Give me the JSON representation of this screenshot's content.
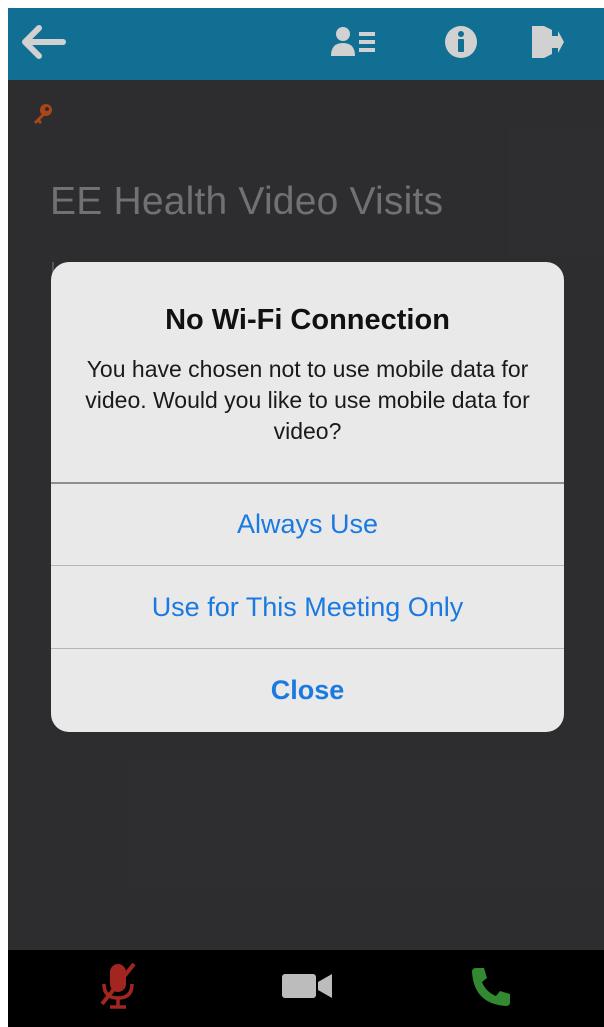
{
  "colors": {
    "toolbar": "#1588b4",
    "background": "#38383a",
    "accent_blue": "#1a7ae0",
    "key_orange": "#d2561c",
    "mute_red": "#c62f27",
    "call_green": "#3ea83a"
  },
  "toolbar": {
    "back_icon": "arrow-left-icon",
    "contacts_icon": "participants-list-icon",
    "info_icon": "info-icon",
    "exit_icon": "exit-door-icon"
  },
  "page": {
    "key_icon": "key-icon",
    "title": "EE Health Video Visits"
  },
  "alert": {
    "title": "No Wi-Fi Connection",
    "message": "You have chosen not to use mobile data for video. Would you like to use mobile data for video?",
    "buttons": {
      "always_use": "Always Use",
      "this_meeting": "Use for This Meeting Only",
      "close": "Close"
    }
  },
  "callbar": {
    "mute_icon": "microphone-muted-icon",
    "video_icon": "video-camera-icon",
    "call_icon": "phone-icon"
  }
}
